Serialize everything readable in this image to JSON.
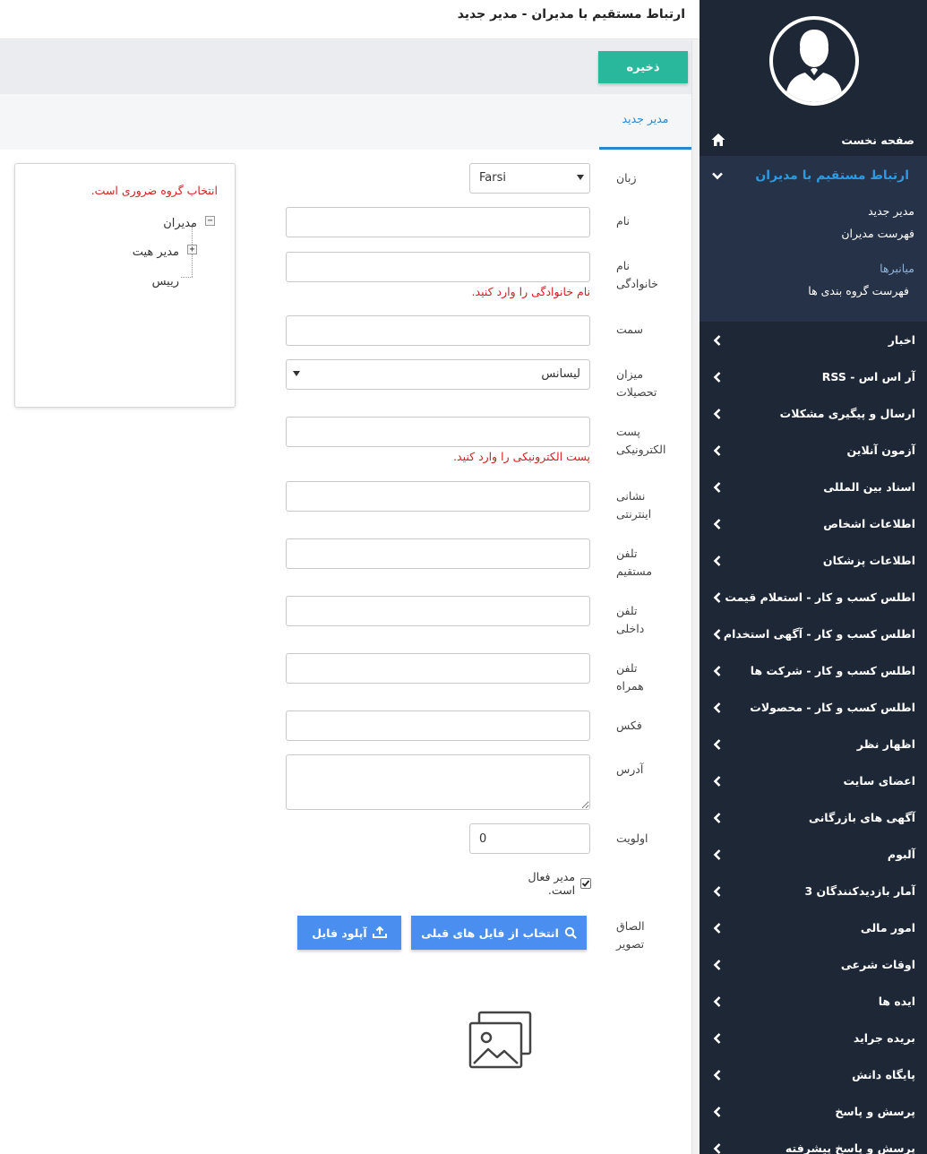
{
  "page": {
    "title": "ارتباط مستقیم با مدیران - مدیر جدید",
    "save_label": "ذخیره",
    "tab_label": "مدیر جدید"
  },
  "form": {
    "language": {
      "label": "زبان",
      "value": "Farsi"
    },
    "first_name": {
      "label": "نام",
      "value": ""
    },
    "last_name": {
      "label": "نام خانوادگی",
      "value": "",
      "error": "نام خانوادگی را وارد کنید."
    },
    "position": {
      "label": "سمت",
      "value": ""
    },
    "education": {
      "label": "میزان تحصیلات",
      "value": "لیسانس"
    },
    "email": {
      "label": "پست الکترونیکی",
      "value": "",
      "error": "پست الکترونیکی را وارد کنید."
    },
    "website": {
      "label": "نشانی اینترنتی",
      "value": ""
    },
    "direct_phone": {
      "label": "تلفن مستقیم",
      "value": ""
    },
    "internal_phone": {
      "label": "تلفن داخلی",
      "value": ""
    },
    "mobile_phone": {
      "label": "تلفن همراه",
      "value": ""
    },
    "fax": {
      "label": "فکس",
      "value": ""
    },
    "address": {
      "label": "آدرس",
      "value": ""
    },
    "priority": {
      "label": "اولویت",
      "value": "0"
    },
    "active": {
      "label": "مدیر فعال است.",
      "checked": true
    },
    "image": {
      "label": "الصاق تصویر",
      "choose_label": "انتخاب از فایل های قبلی",
      "upload_label": "آپلود فایل"
    }
  },
  "tree": {
    "error": "انتخاب گروه ضروری است.",
    "nodes": [
      {
        "label": "مدیران",
        "toggle": "−"
      },
      {
        "label": "مدیر هیت",
        "toggle": "+"
      },
      {
        "label": "رییس"
      }
    ]
  },
  "sidebar": {
    "home": "صفحه نخست",
    "active": "ارتباط مستقیم با مدیران",
    "submenu": {
      "new_manager": "مدیر جدید",
      "manager_list": "فهرست مدیران",
      "shortcuts_title": "میانبرها",
      "group_list": "فهرست گروه بندی ها"
    },
    "items": [
      "اخبار",
      "آر اس اس - RSS",
      "ارسال و پیگیری مشکلات",
      "آزمون آنلاین",
      "اسناد بین المللی",
      "اطلاعات اشخاص",
      "اطلاعات پزشکان",
      "اطلس کسب و کار - استعلام قیمت",
      "اطلس کسب و کار - آگهی استخدام",
      "اطلس کسب و کار - شرکت ها",
      "اطلس کسب و کار - محصولات",
      "اظهار نظر",
      "اعضای سایت",
      "آگهی های بازرگانی",
      "آلبوم",
      "آمار بازدیدکنندگان 3",
      "امور مالی",
      "اوقات شرعی",
      "ایده ها",
      "بریده جراید",
      "پایگاه دانش",
      "پرسش و پاسخ",
      "پرسش و پاسخ پیشرفته"
    ]
  },
  "colors": {
    "sidebar_bg": "#1d2736",
    "accent": "#2c86c9",
    "save_green": "#29b89b",
    "action_blue": "#4a8ff0",
    "error_red": "#d42020"
  }
}
